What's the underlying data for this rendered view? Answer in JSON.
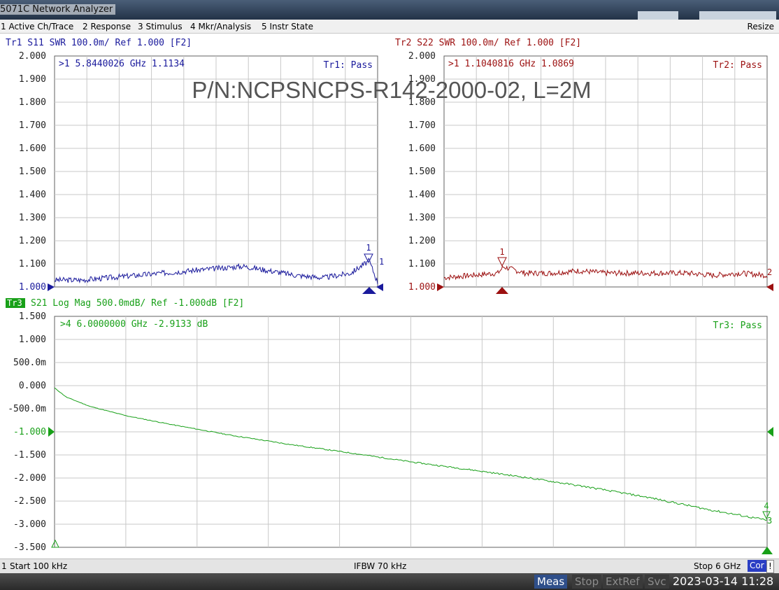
{
  "window": {
    "title": "5071C Network Analyzer"
  },
  "menu": {
    "items": [
      "1 Active Ch/Trace",
      "2 Response",
      "3 Stimulus",
      "4 Mkr/Analysis",
      "5 Instr State"
    ],
    "resize": "Resize"
  },
  "overlay_title": "P/N:NCPSNCPS-R142-2000-02, L=2M",
  "colors": {
    "tr1": "#1a1a9c",
    "tr2": "#9c1010",
    "tr3": "#18a018",
    "grid": "#c8c8c8"
  },
  "traces": {
    "tr1": {
      "header": "Tr1 S11 SWR 100.0m/ Ref 1.000 [F2]",
      "marker_readout": ">1  5.8440026 GHz  1.1134",
      "pass": "Tr1: Pass",
      "ticks": [
        "2.000",
        "1.900",
        "1.800",
        "1.700",
        "1.600",
        "1.500",
        "1.400",
        "1.300",
        "1.200",
        "1.100",
        "1.000"
      ],
      "marker_label": "1"
    },
    "tr2": {
      "header": "Tr2 S22 SWR 100.0m/ Ref 1.000 [F2]",
      "marker_readout": ">1  1.1040816 GHz  1.0869",
      "pass": "Tr2: Pass",
      "ticks": [
        "2.000",
        "1.900",
        "1.800",
        "1.700",
        "1.600",
        "1.500",
        "1.400",
        "1.300",
        "1.200",
        "1.100",
        "1.000"
      ],
      "marker_label": "1",
      "ref_label": "2"
    },
    "tr3": {
      "tag": "Tr3",
      "header": "S21 Log Mag 500.0mdB/ Ref -1.000dB [F2]",
      "marker_readout": ">4  6.0000000 GHz -2.9133 dB",
      "pass": "Tr3: Pass",
      "ticks": [
        "1.500",
        "1.000",
        "500.0m",
        "0.000",
        "-500.0m",
        "-1.000",
        "-1.500",
        "-2.000",
        "-2.500",
        "-3.000",
        "-3.500"
      ],
      "marker_label_4": "4",
      "marker_label_3": "3"
    }
  },
  "chart_data": [
    {
      "type": "line",
      "title": "Tr1 S11 SWR 100.0m/ Ref 1.000 [F2]",
      "x_start_ghz": 0.0001,
      "x_stop_ghz": 6,
      "ylim": [
        1.0,
        2.0
      ],
      "grid": true,
      "series": [
        {
          "name": "S11",
          "x": [
            0.0001,
            0.5,
            1,
            1.5,
            2,
            2.5,
            3,
            3.5,
            4,
            4.5,
            5,
            5.5,
            5.844,
            6
          ],
          "values": [
            1.03,
            1.03,
            1.04,
            1.05,
            1.06,
            1.07,
            1.08,
            1.09,
            1.07,
            1.05,
            1.04,
            1.06,
            1.1134,
            1.02
          ]
        }
      ],
      "marker": {
        "x": 5.8440026,
        "y": 1.1134
      }
    },
    {
      "type": "line",
      "title": "Tr2 S22 SWR 100.0m/ Ref 1.000 [F2]",
      "x_start_ghz": 0.0001,
      "x_stop_ghz": 6,
      "ylim": [
        1.0,
        2.0
      ],
      "grid": true,
      "series": [
        {
          "name": "S22",
          "x": [
            0.0001,
            0.5,
            1,
            1.104,
            1.5,
            2,
            2.5,
            3,
            3.5,
            4,
            4.5,
            5,
            5.5,
            6
          ],
          "values": [
            1.04,
            1.05,
            1.06,
            1.0869,
            1.06,
            1.06,
            1.07,
            1.06,
            1.06,
            1.06,
            1.06,
            1.05,
            1.06,
            1.05
          ]
        }
      ],
      "marker": {
        "x": 1.1040816,
        "y": 1.0869
      }
    },
    {
      "type": "line",
      "title": "S21 Log Mag 500.0mdB/ Ref -1.000dB [F2]",
      "x_start_ghz": 0.0001,
      "x_stop_ghz": 6,
      "ylim": [
        -3.5,
        1.5
      ],
      "grid": true,
      "series": [
        {
          "name": "S21",
          "x": [
            0.0001,
            0.1,
            0.3,
            0.6,
            1,
            1.5,
            2,
            2.5,
            3,
            3.5,
            4,
            4.5,
            5,
            5.5,
            6
          ],
          "values": [
            -0.05,
            -0.25,
            -0.45,
            -0.65,
            -0.85,
            -1.08,
            -1.28,
            -1.46,
            -1.65,
            -1.82,
            -2.0,
            -2.2,
            -2.42,
            -2.68,
            -2.9133
          ]
        }
      ],
      "marker": {
        "x": 6.0,
        "y": -2.9133
      }
    }
  ],
  "status": {
    "channel": "1",
    "start": "Start 100 kHz",
    "ifbw": "IFBW 70 kHz",
    "stop": "Stop 6 GHz",
    "cor": "Cor",
    "bang": "!"
  },
  "bottom": {
    "meas": "Meas",
    "stop": "Stop",
    "extref": "ExtRef",
    "svc": "Svc",
    "clock": "2023-03-14 11:28"
  }
}
